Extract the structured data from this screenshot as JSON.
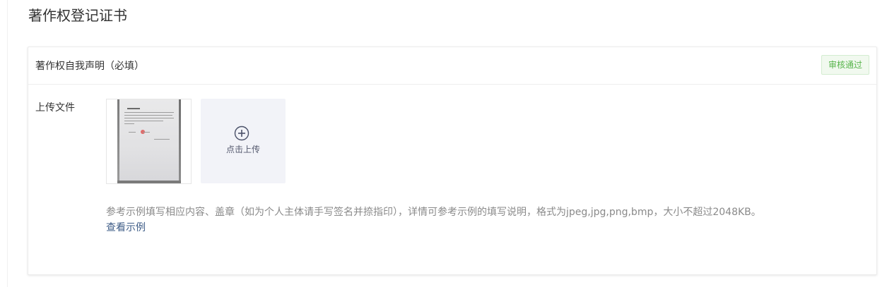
{
  "page": {
    "title": "著作权登记证书"
  },
  "section": {
    "title": "著作权自我声明（必填）",
    "status": "审核通过"
  },
  "upload": {
    "label": "上传文件",
    "button_label": "点击上传",
    "button_icon": "plus-circle-icon",
    "uploaded_files": [
      {
        "type": "image",
        "description": "signed declaration document"
      }
    ],
    "hint": "参考示例填写相应内容、盖章（如为个人主体请手写签名并捺指印），详情可参考示例的填写说明，格式为jpeg,jpg,png,bmp，大小不超过2048KB。",
    "example_link": "查看示例"
  },
  "colors": {
    "status_text": "#56b44a",
    "status_bg": "#f1f9ef",
    "link": "#3e5c87",
    "upload_bg": "#f2f3f8"
  }
}
